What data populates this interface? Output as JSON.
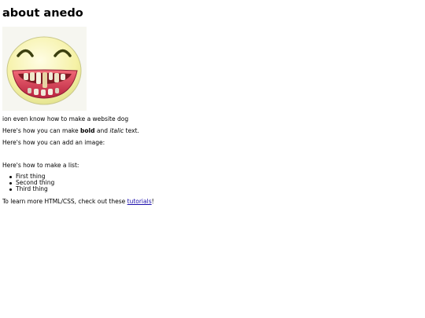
{
  "header": {
    "title": "about anedo"
  },
  "avatar": {
    "icon": "laughing-face-icon",
    "colors": {
      "face": "#f5f1a5",
      "mouth": "#c92d4b",
      "teeth": "#f0ecd9",
      "eyes": "#3b3f0f",
      "background": "#f6f6f0"
    }
  },
  "content": {
    "intro": "ion even know how to make a website dog",
    "bold_line": {
      "prefix": "Here's how you can make ",
      "bold": "bold",
      "middle": " and ",
      "italic": "italic",
      "suffix": " text."
    },
    "image_line": "Here's how you can add an image:",
    "list_intro": "Here's how to make a list:",
    "list_items": [
      "First thing",
      "Second thing",
      "Third thing"
    ],
    "learn_line": {
      "prefix": "To learn more HTML/CSS, check out these ",
      "link": "tutorials",
      "suffix": "!"
    }
  },
  "colors": {
    "link": "#1a0dab",
    "text": "#000000",
    "background": "#ffffff"
  }
}
